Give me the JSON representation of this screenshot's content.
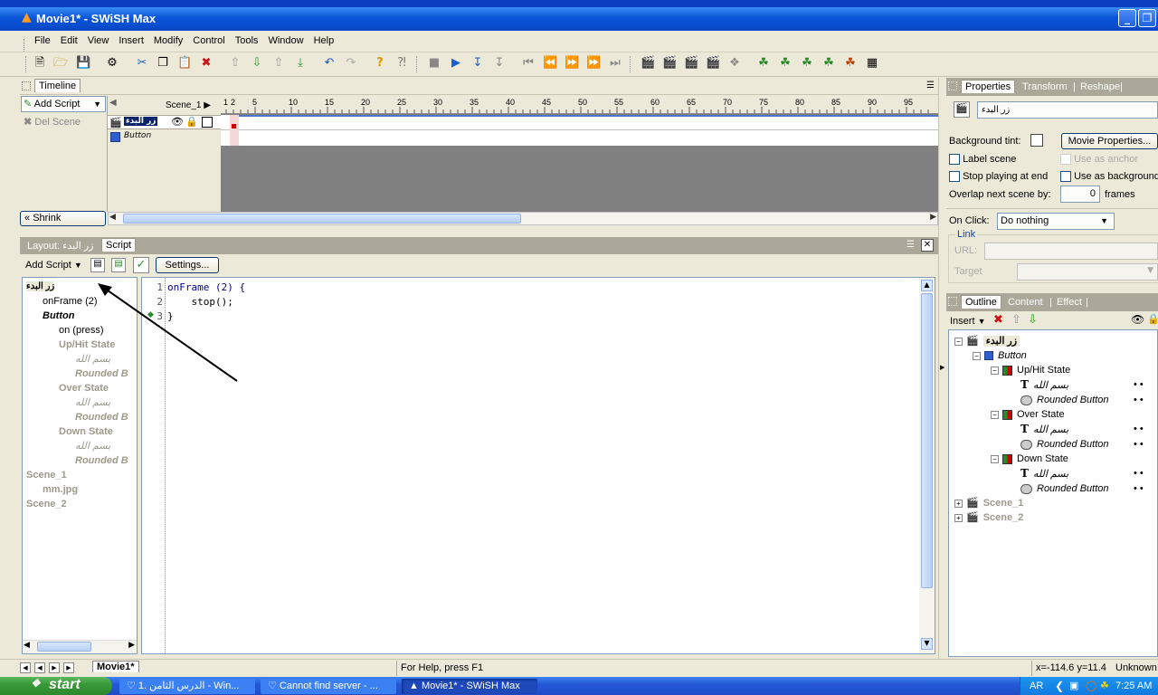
{
  "window": {
    "title": "Movie1* - SWiSH Max"
  },
  "menu": [
    "File",
    "Edit",
    "View",
    "Insert",
    "Modify",
    "Control",
    "Tools",
    "Window",
    "Help"
  ],
  "timeline": {
    "tab": "Timeline",
    "add_script": "Add Script",
    "del_scene": "Del Scene",
    "scene_label": "Scene_1",
    "layers": [
      {
        "name": "زر البدء"
      },
      {
        "name": "Button"
      }
    ],
    "ruler_ticks": [
      "1",
      "2",
      "5",
      "10",
      "15",
      "20",
      "25",
      "30",
      "35",
      "40",
      "45",
      "50",
      "55",
      "60",
      "65",
      "70",
      "75",
      "80",
      "85",
      "90",
      "95"
    ],
    "shrink": "Shrink"
  },
  "script_panel": {
    "tab_layout": "Layout: زر البدء",
    "tab_script": "Script",
    "add_script": "Add Script",
    "settings": "Settings...",
    "tree": [
      {
        "text": "زر البدء",
        "style": "sel",
        "indent": 0
      },
      {
        "text": "onFrame (2)",
        "style": "normal",
        "indent": 1
      },
      {
        "text": "Button",
        "style": "bolditalic",
        "indent": 1
      },
      {
        "text": "on (press)",
        "style": "normal",
        "indent": 2
      },
      {
        "text": "Up/Hit State",
        "style": "greyb",
        "indent": 2
      },
      {
        "text": "بسم الله",
        "style": "greyi",
        "indent": 3
      },
      {
        "text": "Rounded B",
        "style": "greybi",
        "indent": 3
      },
      {
        "text": "Over State",
        "style": "greyb",
        "indent": 2
      },
      {
        "text": "بسم الله",
        "style": "greyi",
        "indent": 3
      },
      {
        "text": "Rounded B",
        "style": "greybi",
        "indent": 3
      },
      {
        "text": "Down State",
        "style": "greyb",
        "indent": 2
      },
      {
        "text": "بسم الله",
        "style": "greyi",
        "indent": 3
      },
      {
        "text": "Rounded B",
        "style": "greybi",
        "indent": 3
      },
      {
        "text": "Scene_1",
        "style": "greyb",
        "indent": 0
      },
      {
        "text": "mm.jpg",
        "style": "greyb",
        "indent": 1
      },
      {
        "text": "Scene_2",
        "style": "greyb",
        "indent": 0
      }
    ],
    "code_lines": [
      {
        "num": "1",
        "text": "onFrame (2) {"
      },
      {
        "num": "2",
        "text": "    stop();"
      },
      {
        "num": "3",
        "text": "}"
      }
    ]
  },
  "properties": {
    "tabs": [
      "Properties",
      "Transform",
      "Reshape"
    ],
    "name_value": "زر البدء",
    "background_tint": "Background tint:",
    "movie_properties": "Movie Properties...",
    "label_scene": "Label scene",
    "use_as_anchor": "Use as anchor",
    "stop_playing": "Stop playing at end",
    "use_as_background": "Use as background",
    "overlap_label": "Overlap next scene by:",
    "overlap_value": "0",
    "frames": "frames",
    "on_click_label": "On Click:",
    "on_click_value": "Do nothing",
    "link_group": "Link",
    "url_label": "URL:",
    "target_label": "Target"
  },
  "outline": {
    "tabs": [
      "Outline",
      "Content",
      "Effect"
    ],
    "insert": "Insert",
    "items": [
      {
        "text": "زر البدء",
        "style": "bold",
        "indent": 0,
        "icon": "scene-icon"
      },
      {
        "text": "Button",
        "style": "italic",
        "indent": 1,
        "icon": "button-icon"
      },
      {
        "text": "Up/Hit State",
        "style": "normal",
        "indent": 2,
        "icon": "state-icon"
      },
      {
        "text": "بسم الله",
        "style": "italic",
        "indent": 3,
        "icon": "text-icon"
      },
      {
        "text": "Rounded Button",
        "style": "italic",
        "indent": 3,
        "icon": "shape-icon"
      },
      {
        "text": "Over State",
        "style": "normal",
        "indent": 2,
        "icon": "state-icon"
      },
      {
        "text": "بسم الله",
        "style": "italic",
        "indent": 3,
        "icon": "text-icon"
      },
      {
        "text": "Rounded Button",
        "style": "italic",
        "indent": 3,
        "icon": "shape-icon"
      },
      {
        "text": "Down State",
        "style": "normal",
        "indent": 2,
        "icon": "state-icon"
      },
      {
        "text": "بسم الله",
        "style": "italic",
        "indent": 3,
        "icon": "text-icon"
      },
      {
        "text": "Rounded Button",
        "style": "italic",
        "indent": 3,
        "icon": "shape-icon"
      },
      {
        "text": "Scene_1",
        "style": "greyb",
        "indent": 0,
        "icon": "scene-icon"
      },
      {
        "text": "Scene_2",
        "style": "greyb",
        "indent": 0,
        "icon": "scene-icon"
      }
    ]
  },
  "status": {
    "scene_tab": "Movie1*",
    "help": "For Help, press F1",
    "coords": "x=-114.6 y=11.4",
    "mode": "Unknown"
  },
  "taskbar": {
    "start": "start",
    "tasks": [
      "1. الدرس الثامن - Win...",
      "Cannot find server - ...",
      "Movie1* - SWiSH Max"
    ],
    "lang": "AR",
    "time": "7:25 AM"
  },
  "colors": {
    "xp_blue": "#0a55d8",
    "panel": "#ece9d8",
    "tree_red": "#cc0000"
  }
}
